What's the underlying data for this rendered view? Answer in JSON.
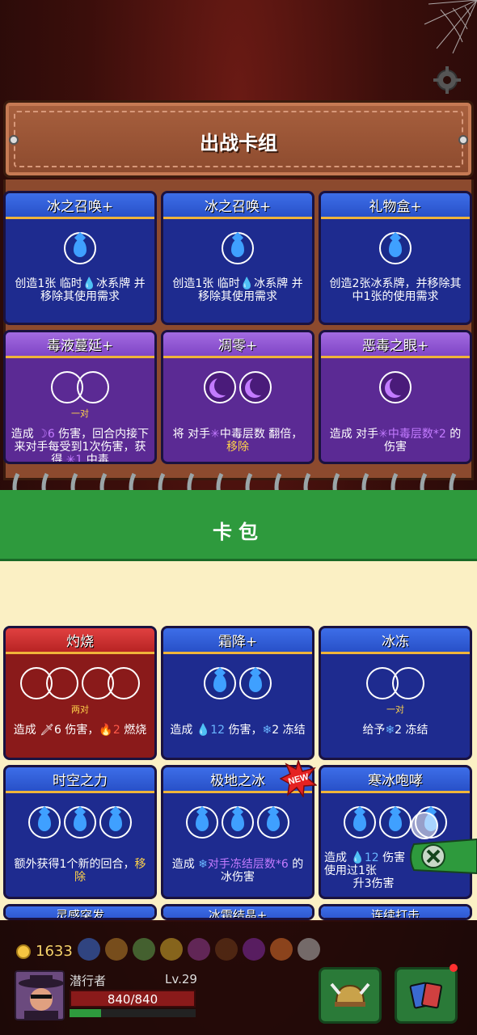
{
  "deck": {
    "title": "出战卡组",
    "cards": [
      {
        "name": "冰之召唤+",
        "color": "blue",
        "cost_icon": "water-drop-icon",
        "cost_count": 1,
        "desc_parts": [
          "创造1张 临时",
          "冰系牌 并移除其使用需求"
        ]
      },
      {
        "name": "冰之召唤+",
        "color": "blue",
        "cost_icon": "water-drop-icon",
        "cost_count": 1,
        "desc_parts": [
          "创造1张 临时",
          "冰系牌 并移除其使用需求"
        ]
      },
      {
        "name": "礼物盒+",
        "color": "blue",
        "cost_icon": "water-drop-icon",
        "cost_count": 1,
        "desc": "创造2张冰系牌，并移除其中1张的使用需求"
      },
      {
        "name": "毒液蔓延+",
        "color": "purple",
        "cost_icon": "empty-pair",
        "pair_label": "一对",
        "desc_parts": [
          "造成 ",
          "6",
          " 伤害，回合内接下来对手每受到1次伤害，获得 ",
          "1",
          " 中毒"
        ]
      },
      {
        "name": "凋零+",
        "color": "purple",
        "cost_icon": "moon-icon",
        "cost_count": 2,
        "desc_parts": [
          "将 对手",
          "中毒层数 翻倍，",
          "移除"
        ]
      },
      {
        "name": "恶毒之眼+",
        "color": "purple",
        "cost_icon": "moon-icon",
        "cost_count": 1,
        "desc_parts": [
          "造成 对手",
          "中毒层数*2",
          " 的伤害"
        ]
      }
    ]
  },
  "pack": {
    "title": "卡包",
    "cards": [
      {
        "name": "灼烧",
        "color": "red",
        "pair_label": "两对",
        "desc_parts": [
          "造成 ",
          "6 伤害，",
          "2",
          " 燃烧"
        ]
      },
      {
        "name": "霜降+",
        "color": "blue",
        "cost_count": 2,
        "desc_parts": [
          "造成 ",
          "12",
          " 伤害，",
          "2",
          " 冻结"
        ]
      },
      {
        "name": "冰冻",
        "color": "blue",
        "pair_label": "一对",
        "desc_parts": [
          "给予",
          "2",
          " 冻结"
        ]
      },
      {
        "name": "时空之力",
        "color": "blue",
        "cost_count": 3,
        "desc_parts": [
          "额外获得1个新的回合，",
          "移除"
        ]
      },
      {
        "name": "极地之冰",
        "color": "blue",
        "cost_count": 3,
        "is_new": true,
        "new_label": "NEW",
        "desc_parts": [
          "造成 ",
          "对手冻结层数*6",
          " 的冰伤害"
        ]
      },
      {
        "name": "寒冰咆哮",
        "color": "blue",
        "cost_count": 3,
        "desc_parts": [
          "造成 ",
          "12",
          " 伤害",
          "使用过1张",
          "升3伤害"
        ]
      }
    ],
    "partial_names": [
      "灵感突发",
      "冰霜结晶+",
      "连续打击"
    ]
  },
  "player": {
    "gold": "1633",
    "name": "潜行者",
    "level": "Lv.29",
    "hp": "840/840",
    "xp_fraction": 0.25
  },
  "colors": {
    "blue_card": "#1e2b8f",
    "purple_card": "#5b2a94",
    "red_card": "#8a1a1a",
    "pack_green": "#2e9a3d",
    "highlight_yellow": "#ffd34a",
    "poison_purple": "#c37bff",
    "ice_blue": "#6ab6ff"
  }
}
